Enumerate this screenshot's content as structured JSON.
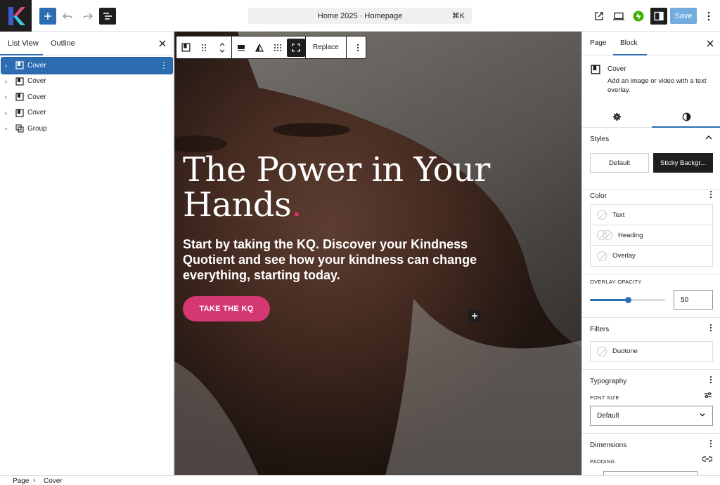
{
  "topbar": {
    "document_title": "Home 2025 · Homepage",
    "shortcut": "⌘K",
    "save_label": "Save"
  },
  "left_sidebar": {
    "tabs": [
      "List View",
      "Outline"
    ],
    "active_tab": "List View",
    "items": [
      {
        "label": "Cover",
        "type": "cover",
        "selected": true
      },
      {
        "label": "Cover",
        "type": "cover",
        "selected": false
      },
      {
        "label": "Cover",
        "type": "cover",
        "selected": false
      },
      {
        "label": "Cover",
        "type": "cover",
        "selected": false
      },
      {
        "label": "Group",
        "type": "group",
        "selected": false
      }
    ]
  },
  "block_toolbar": {
    "replace_label": "Replace"
  },
  "hero": {
    "title": "The Power in Your Hands",
    "title_dot": ".",
    "subtitle": "Start by taking the KQ. Discover your Kindness Quotient and see how your kindness can change everything, starting today.",
    "cta_label": "TAKE THE KQ"
  },
  "right_sidebar": {
    "tabs": [
      "Page",
      "Block"
    ],
    "active_tab": "Block",
    "block": {
      "name": "Cover",
      "description": "Add an image or video with a text overlay."
    },
    "styles": {
      "title": "Styles",
      "options": [
        "Default",
        "Sticky Backgr..."
      ],
      "selected": "Sticky Backgr..."
    },
    "color": {
      "title": "Color",
      "items": [
        "Text",
        "Heading",
        "Overlay"
      ]
    },
    "overlay_opacity": {
      "label": "OVERLAY OPACITY",
      "value": "50",
      "fraction": 0.5
    },
    "filters": {
      "title": "Filters",
      "items": [
        "Duotone"
      ]
    },
    "typography": {
      "title": "Typography",
      "font_size_label": "FONT SIZE",
      "font_size_value": "Default"
    },
    "dimensions": {
      "title": "Dimensions",
      "padding_label": "PADDING"
    }
  },
  "breadcrumb": [
    "Page",
    "Cover"
  ],
  "colors": {
    "accent": "#2c6db2",
    "cta": "#d33873",
    "dark": "#1e1e1e"
  }
}
